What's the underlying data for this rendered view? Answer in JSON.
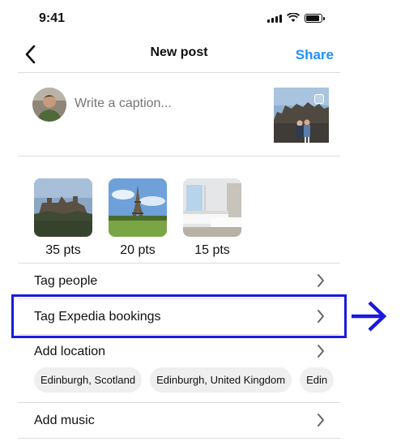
{
  "status_bar": {
    "time": "9:41"
  },
  "header": {
    "title": "New post",
    "share_label": "Share"
  },
  "caption": {
    "placeholder": "Write a caption..."
  },
  "rewards": [
    {
      "points": "35 pts",
      "image": "castle-photo"
    },
    {
      "points": "20 pts",
      "image": "eiffel-tower-photo"
    },
    {
      "points": "15 pts",
      "image": "hotel-room-photo"
    }
  ],
  "menu": {
    "tag_people": "Tag people",
    "tag_bookings": "Tag Expedia bookings",
    "add_location": "Add location",
    "add_music": "Add music"
  },
  "location_chips": [
    "Edinburgh, Scotland",
    "Edinburgh, United Kingdom",
    "Edin"
  ],
  "colors": {
    "accent": "#1e90ff",
    "highlight": "#1a1ae0",
    "chip_bg": "#efefef"
  }
}
